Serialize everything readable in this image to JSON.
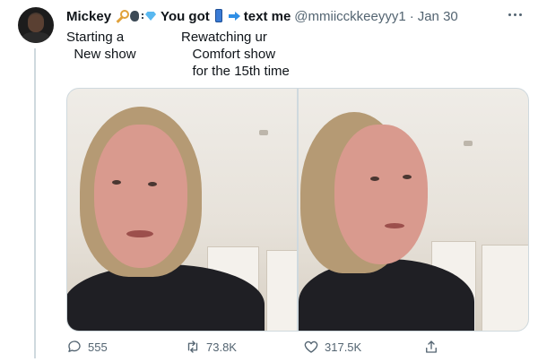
{
  "tweet": {
    "author": {
      "display_name": "Mickey",
      "name_suffix_1": "You got",
      "name_suffix_2": "text me",
      "handle": "@mmiicckkeeyyy1",
      "separator": "·",
      "date": "Jan 30",
      "name_emoji_icons": [
        "key-icon",
        "speaking-head-icon",
        "gem-icon"
      ],
      "suffix_emoji_icons": [
        "phone-icon",
        "arrow-icon"
      ]
    },
    "caption_left": "Starting a\n  New show",
    "caption_right": "Rewatching ur\n   Comfort show\n   for the 15th time",
    "media": {
      "photo_count": 2
    },
    "actions": {
      "reply_count": "555",
      "retweet_count": "73.8K",
      "like_count": "317.5K",
      "reply_icon": "reply-icon",
      "retweet_icon": "retweet-icon",
      "like_icon": "heart-icon",
      "share_icon": "share-icon"
    },
    "colors": {
      "text": "#0f1419",
      "secondary": "#536471",
      "divider": "#cfd9de"
    }
  }
}
